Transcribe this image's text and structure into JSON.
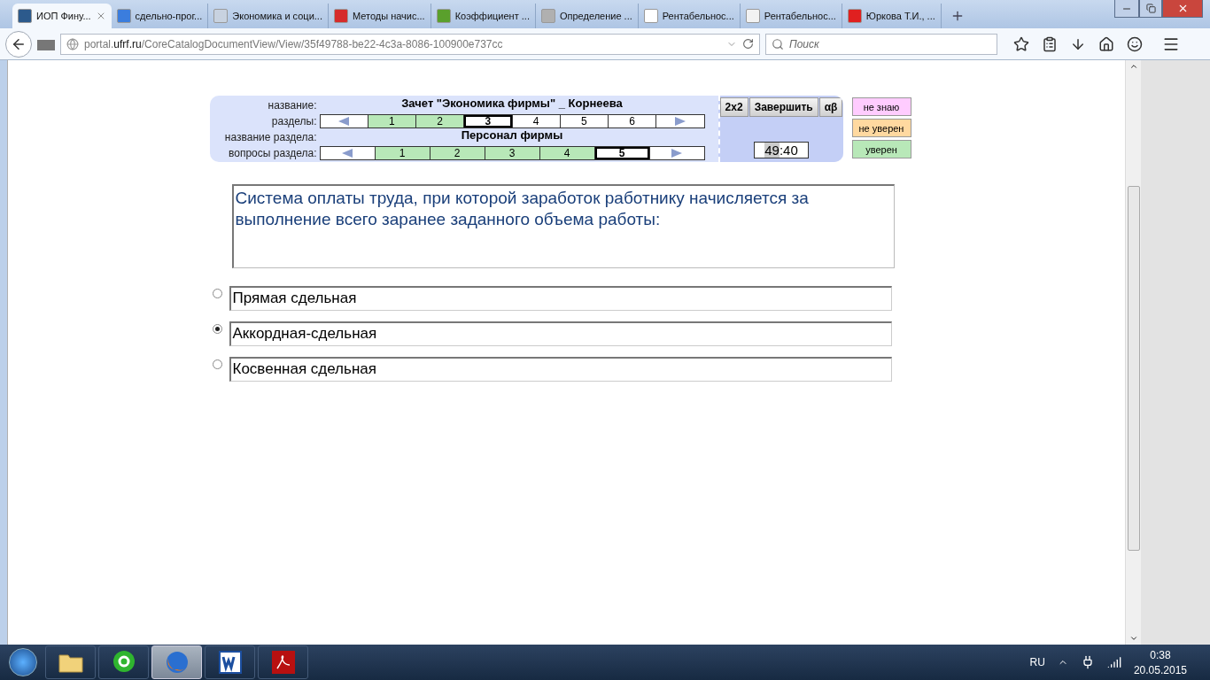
{
  "browser": {
    "tabs": [
      {
        "label": "ИОП Фину...",
        "selected": true,
        "color": "#2c5a8c"
      },
      {
        "label": "сдельно-прог...",
        "selected": false,
        "color": "#3b7ddd"
      },
      {
        "label": "Экономика и соци...",
        "selected": false,
        "color": "#c8d2e0"
      },
      {
        "label": "Методы начис...",
        "selected": false,
        "color": "#d62b2b"
      },
      {
        "label": "Коэффициент ...",
        "selected": false,
        "color": "#5aa02c"
      },
      {
        "label": "Определение ...",
        "selected": false,
        "color": "#b0b0b0"
      },
      {
        "label": "Рентабельнос...",
        "selected": false,
        "color": "#ffffff"
      },
      {
        "label": "Рентабельнос...",
        "selected": false,
        "color": "#f2f2f2"
      },
      {
        "label": "Юркова Т.И., ...",
        "selected": false,
        "color": "#e02020"
      }
    ],
    "url": {
      "prefix": "portal.",
      "host": "ufrf.ru",
      "path": "/CoreCatalogDocumentView/View/35f49788-be22-4c3a-8086-100900e737cc"
    },
    "search": {
      "placeholder": "Поиск"
    }
  },
  "test": {
    "title_label": "название:",
    "title": "Зачет \"Экономика фирмы\" _ Корнеева",
    "sections_label": "разделы:",
    "sections": [
      {
        "label": "1",
        "answered": true,
        "selected": false
      },
      {
        "label": "2",
        "answered": true,
        "selected": false
      },
      {
        "label": "3",
        "answered": false,
        "selected": true
      },
      {
        "label": "4",
        "answered": false,
        "selected": false
      },
      {
        "label": "5",
        "answered": false,
        "selected": false
      },
      {
        "label": "6",
        "answered": false,
        "selected": false
      }
    ],
    "section_name_label": "название раздела:",
    "section_name": "Персонал фирмы",
    "questions_label": "вопросы раздела:",
    "questions": [
      {
        "label": "1",
        "answered": true,
        "selected": false
      },
      {
        "label": "2",
        "answered": true,
        "selected": false
      },
      {
        "label": "3",
        "answered": true,
        "selected": false
      },
      {
        "label": "4",
        "answered": true,
        "selected": false
      },
      {
        "label": "5",
        "answered": false,
        "selected": true
      }
    ],
    "tools": [
      "2x2",
      "Завершить",
      "αβ"
    ],
    "timer": {
      "highlighted": "49",
      "rest": ":40"
    },
    "confidence": [
      {
        "label": "не знаю",
        "color": "#ffccff"
      },
      {
        "label": "не уверен",
        "color": "#ffd9a0"
      },
      {
        "label": "уверен",
        "color": "#b8e8b8"
      }
    ],
    "question": "Система оплаты труда, при которой заработок работнику начисляется за выполнение всего заранее заданного объема работы:",
    "options": [
      {
        "text": "Прямая сдельная",
        "selected": false
      },
      {
        "text": "Аккордная-сдельная",
        "selected": true
      },
      {
        "text": "Косвенная сдельная",
        "selected": false
      }
    ]
  },
  "taskbar": {
    "apps": [
      {
        "kind": "folder",
        "selected": false
      },
      {
        "kind": "mail",
        "selected": false
      },
      {
        "kind": "browser",
        "selected": true
      },
      {
        "kind": "word",
        "selected": false
      },
      {
        "kind": "pdf",
        "selected": false
      }
    ],
    "language": "RU",
    "time": "0:38",
    "date": "20.05.2015"
  }
}
